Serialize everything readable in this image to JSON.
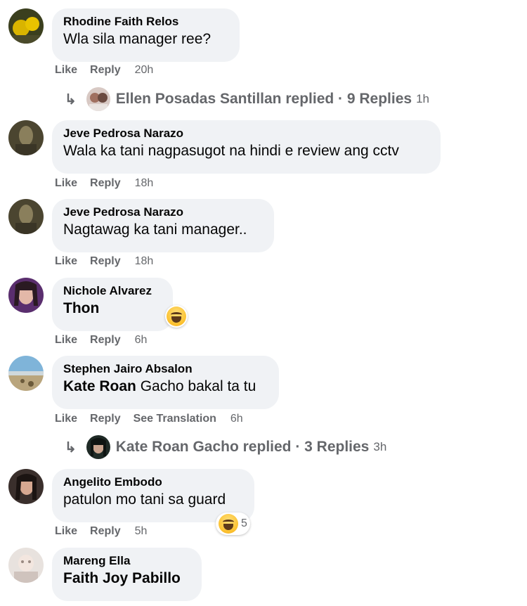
{
  "actions": {
    "like": "Like",
    "reply": "Reply",
    "see_translation": "See Translation"
  },
  "comments": [
    {
      "author": "Rhodine Faith Relos",
      "text": "Wla sila manager ree?",
      "time": "20h"
    },
    {
      "author": "Jeve Pedrosa Narazo",
      "text": "Wala ka tani nagpasugot na hindi e review ang cctv",
      "time": "18h"
    },
    {
      "author": "Jeve Pedrosa Narazo",
      "text": "Nagtawag ka tani manager..",
      "time": "18h"
    },
    {
      "author": "Nichole Alvarez",
      "text": "Thon",
      "time": "6h",
      "reaction_icon": "laugh-emoji-icon"
    },
    {
      "author": "Stephen Jairo Absalon",
      "tag": "Kate Roan",
      "text": " Gacho bakal ta tu",
      "time": "6h"
    },
    {
      "author": "Angelito Embodo",
      "text": "patulon mo tani sa guard",
      "time": "5h",
      "reaction_icon": "laugh-emoji-icon",
      "reaction_count": "5"
    },
    {
      "author": "Mareng Ella",
      "tag": "Faith Joy Pabillo",
      "text": ""
    }
  ],
  "reply_threads": [
    {
      "label": "Ellen Posadas Santillan replied · 9 Replies",
      "time": "1h"
    },
    {
      "label": "Kate Roan Gacho replied · 3 Replies",
      "time": "3h"
    }
  ],
  "colors": {
    "bubble": "#f0f2f5",
    "meta": "#65676b",
    "text": "#050505"
  }
}
